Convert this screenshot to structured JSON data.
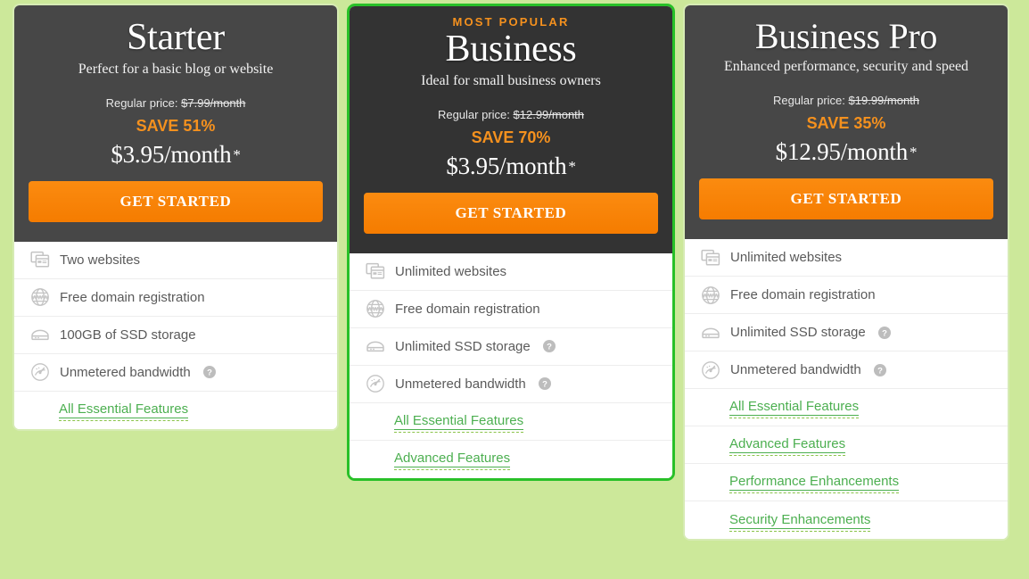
{
  "plans": [
    {
      "badge": "",
      "name": "Starter",
      "description": "Perfect for a basic blog or website",
      "regular_label": "Regular price:",
      "regular_price": "$7.99/month",
      "save": "SAVE 51%",
      "price": "$3.95/month",
      "price_star": "*",
      "cta": "GET STARTED",
      "features": [
        {
          "icon": "websites-icon",
          "text": "Two websites",
          "help": false
        },
        {
          "icon": "www-globe-icon",
          "text": "Free domain registration",
          "help": false
        },
        {
          "icon": "ssd-storage-icon",
          "text": "100GB of SSD storage",
          "help": false
        },
        {
          "icon": "bandwidth-gauge-icon",
          "text": "Unmetered bandwidth",
          "help": true
        }
      ],
      "links": [
        "All Essential Features"
      ]
    },
    {
      "badge": "MOST POPULAR",
      "name": "Business",
      "description": "Ideal for small business owners",
      "regular_label": "Regular price:",
      "regular_price": "$12.99/month",
      "save": "SAVE 70%",
      "price": "$3.95/month",
      "price_star": "*",
      "cta": "GET STARTED",
      "features": [
        {
          "icon": "websites-icon",
          "text": "Unlimited websites",
          "help": false
        },
        {
          "icon": "www-globe-icon",
          "text": "Free domain registration",
          "help": false
        },
        {
          "icon": "ssd-storage-icon",
          "text": "Unlimited SSD storage",
          "help": true
        },
        {
          "icon": "bandwidth-gauge-icon",
          "text": "Unmetered bandwidth",
          "help": true
        }
      ],
      "links": [
        "All Essential Features",
        "Advanced Features"
      ]
    },
    {
      "badge": "",
      "name": "Business Pro",
      "description": "Enhanced performance, security and speed",
      "regular_label": "Regular price:",
      "regular_price": "$19.99/month",
      "save": "SAVE 35%",
      "price": "$12.95/month",
      "price_star": "*",
      "cta": "GET STARTED",
      "features": [
        {
          "icon": "websites-icon",
          "text": "Unlimited websites",
          "help": false
        },
        {
          "icon": "www-globe-icon",
          "text": "Free domain registration",
          "help": false
        },
        {
          "icon": "ssd-storage-icon",
          "text": "Unlimited SSD storage",
          "help": true
        },
        {
          "icon": "bandwidth-gauge-icon",
          "text": "Unmetered bandwidth",
          "help": true
        }
      ],
      "links": [
        "All Essential Features",
        "Advanced Features",
        "Performance Enhancements",
        "Security Enhancements"
      ]
    }
  ],
  "colors": {
    "page_background": "#cce89a",
    "header_background": "#474747",
    "featured_header_background": "#333333",
    "featured_border": "#28c028",
    "accent_orange": "#f5911e",
    "cta_orange": "#fb8b10",
    "link_green": "#4caf50",
    "icon_gray": "#c4c4c4"
  }
}
